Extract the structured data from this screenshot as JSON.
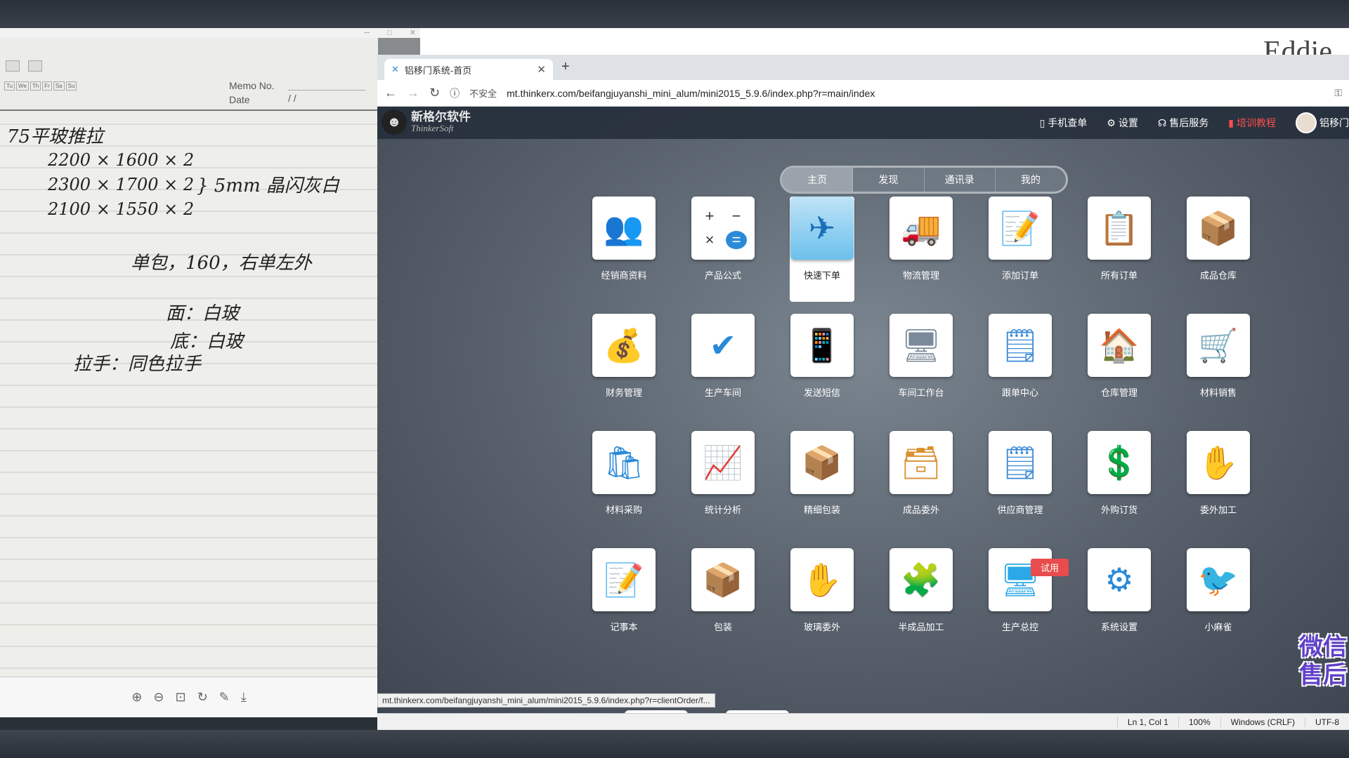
{
  "watermark": "Eddie",
  "viewer": {
    "memo_no_label": "Memo No.",
    "date_label": "Date",
    "date_value": "/        /",
    "days": [
      "Tu",
      "We",
      "Th",
      "Fr",
      "Sa",
      "Su"
    ],
    "handwriting": [
      "75平玻推拉",
      "2200 × 1600 × 2",
      "2300 × 1700 × 2",
      "2100 × 1550 × 2",
      "} 5mm 晶闪灰白",
      "单包，160，右单左外",
      "面：白玻",
      "底：白玻",
      "拉手：同色拉手"
    ]
  },
  "browser": {
    "tab_title": "铝移门系统-首页",
    "insecure_label": "不安全",
    "url": "mt.thinkerx.com/beifangjuyanshi_mini_alum/mini2015_5.9.6/index.php?r=main/index",
    "status_link": "mt.thinkerx.com/beifangjuyanshi_mini_alum/mini2015_5.9.6/index.php?r=clientOrder/f..."
  },
  "app": {
    "logo_cn": "新格尔软件",
    "logo_en": "ThinkerSoft",
    "nav": [
      {
        "icon": "phone-icon",
        "label": "手机查单"
      },
      {
        "icon": "gear-icon",
        "label": "设置"
      },
      {
        "icon": "headset-icon",
        "label": "售后服务"
      },
      {
        "icon": "book-icon",
        "label": "培训教程"
      },
      {
        "icon": "avatar-icon",
        "label": "铝移门"
      }
    ],
    "tabs": [
      "主页",
      "发现",
      "通讯录",
      "我的"
    ],
    "trial_badge": "试用",
    "wechat_text": [
      "微信",
      "售后"
    ],
    "tiles": [
      {
        "label": "经销商资料",
        "icon": "👥",
        "color": "#4a5a6a"
      },
      {
        "label": "产品公式",
        "icon": "calculator",
        "color": "#2a8ad8"
      },
      {
        "label": "快速下单",
        "icon": "✈",
        "color": "#3aa0e0"
      },
      {
        "label": "物流管理",
        "icon": "🚚",
        "color": "#f08a1a"
      },
      {
        "label": "添加订单",
        "icon": "📝",
        "color": "#3cb34a"
      },
      {
        "label": "所有订单",
        "icon": "📋",
        "color": "#f3a12a"
      },
      {
        "label": "成品仓库",
        "icon": "📦",
        "color": "#d99030"
      },
      {
        "label": "财务管理",
        "icon": "💰",
        "color": "#f0a020"
      },
      {
        "label": "生产车间",
        "icon": "✔",
        "color": "#2a8ad8"
      },
      {
        "label": "发送短信",
        "icon": "📱",
        "color": "#333"
      },
      {
        "label": "车间工作台",
        "icon": "🖥",
        "color": "#7a8a9a"
      },
      {
        "label": "跟单中心",
        "icon": "🗒",
        "color": "#3a8ad8"
      },
      {
        "label": "仓库管理",
        "icon": "🏠",
        "color": "#e04040"
      },
      {
        "label": "材料销售",
        "icon": "🛒",
        "color": "#333"
      },
      {
        "label": "材料采购",
        "icon": "🛍",
        "color": "#2a8ad8"
      },
      {
        "label": "统计分析",
        "icon": "📈",
        "color": "#e04040"
      },
      {
        "label": "精细包装",
        "icon": "📦",
        "color": "#d99030"
      },
      {
        "label": "成品委外",
        "icon": "🗃",
        "color": "#d99030"
      },
      {
        "label": "供应商管理",
        "icon": "🗒",
        "color": "#3a8ad8"
      },
      {
        "label": "外购订货",
        "icon": "💲",
        "color": "#f0a020"
      },
      {
        "label": "委外加工",
        "icon": "✋",
        "color": "#2a8ad8"
      },
      {
        "label": "记事本",
        "icon": "📝",
        "color": "#555"
      },
      {
        "label": "包装",
        "icon": "📦",
        "color": "#d99030"
      },
      {
        "label": "玻璃委外",
        "icon": "✋",
        "color": "#2a8ad8"
      },
      {
        "label": "半成品加工",
        "icon": "🧩",
        "color": "#2a8ad8"
      },
      {
        "label": "生产总控",
        "icon": "🖥",
        "color": "#2aa8e8"
      },
      {
        "label": "系统设置",
        "icon": "⚙",
        "color": "#2a8ad8"
      },
      {
        "label": "小麻雀",
        "icon": "🐦",
        "color": "#222"
      }
    ]
  },
  "statusbar": {
    "position": "Ln 1, Col 1",
    "zoom": "100%",
    "eol": "Windows (CRLF)",
    "encoding": "UTF-8"
  }
}
